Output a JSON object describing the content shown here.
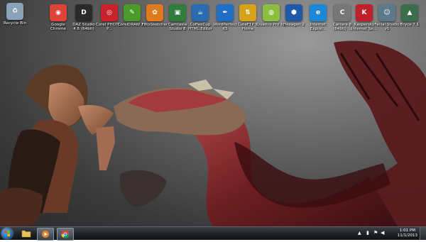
{
  "desktop_icons": [
    {
      "label": "Recycle Bin",
      "icon": "recycle-bin-icon",
      "color": "#8aa3b8",
      "glyph": "♻"
    },
    {
      "label": "Google Chrome",
      "icon": "chrome-icon",
      "color": "#db4437",
      "glyph": "◉"
    },
    {
      "label": "DAZ Studio 4.6 (64bit)",
      "icon": "daz-studio-icon",
      "color": "#2a2a2a",
      "glyph": "D"
    },
    {
      "label": "Corel PHOTO-P...",
      "icon": "corel-photo-paint-icon",
      "color": "#c8232c",
      "glyph": "◎"
    },
    {
      "label": "CorelDRAW X5",
      "icon": "coreldraw-icon",
      "color": "#4c9a2a",
      "glyph": "✎"
    },
    {
      "label": "FotoSketcher",
      "icon": "fotosketcher-icon",
      "color": "#e07a1f",
      "glyph": "✿"
    },
    {
      "label": "Camtasia Studio 8",
      "icon": "camtasia-icon",
      "color": "#2f7d3a",
      "glyph": "▣"
    },
    {
      "label": "CoffeeCup HTML Editor",
      "icon": "coffeecup-icon",
      "color": "#2b6cb0",
      "glyph": "☕"
    },
    {
      "label": "WordPerfect X5",
      "icon": "wordperfect-icon",
      "color": "#1f6fc6",
      "glyph": "✒"
    },
    {
      "label": "CuteFTP 8 Home",
      "icon": "cuteftp-icon",
      "color": "#d6a21a",
      "glyph": "⇅"
    },
    {
      "label": "Quattro Pro X5",
      "icon": "quattro-pro-icon",
      "color": "#8cbf3f",
      "glyph": "◍"
    },
    {
      "label": "Hexagon 2",
      "icon": "hexagon-icon",
      "color": "#1e5aa8",
      "glyph": "⬢"
    },
    {
      "label": "Internet Explor...",
      "icon": "internet-explorer-icon",
      "color": "#1e88d8",
      "glyph": "e"
    },
    {
      "label": "Carrara 8 (64bit) ...",
      "icon": "carrara-icon",
      "color": "#777777",
      "glyph": "C"
    },
    {
      "label": "Kaspersky Internet Se...",
      "icon": "kaspersky-icon",
      "color": "#c0202a",
      "glyph": "K"
    },
    {
      "label": "Facial Studio v1",
      "icon": "facial-studio-icon",
      "color": "#5c7a8a",
      "glyph": "☺"
    },
    {
      "label": "Bryce 7.1",
      "icon": "bryce-icon",
      "color": "#3b6e4a",
      "glyph": "▲"
    }
  ],
  "taskbar": {
    "pinned": [
      {
        "name": "windows-explorer",
        "icon": "folder-icon",
        "color": "#e7c35a"
      },
      {
        "name": "media-player",
        "icon": "media-player-icon",
        "color": "#e6842a"
      },
      {
        "name": "chrome",
        "icon": "chrome-icon",
        "color": "#db4437"
      }
    ],
    "time": "1:01 PM",
    "date": "11/1/2013"
  }
}
